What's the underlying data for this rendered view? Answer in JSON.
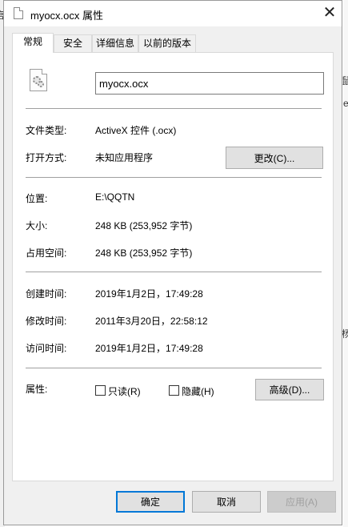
{
  "background": {
    "left_fragment": "官",
    "right_fragments": [
      "鼠",
      "e",
      "杨"
    ]
  },
  "window": {
    "title": "myocx.ocx 属性",
    "close_glyph": "✕"
  },
  "tabs": [
    {
      "label": "常规",
      "active": true
    },
    {
      "label": "安全",
      "active": false
    },
    {
      "label": "详细信息",
      "active": false
    },
    {
      "label": "以前的版本",
      "active": false
    }
  ],
  "general": {
    "file_icon": "gear-file-icon",
    "filename": "myocx.ocx",
    "file_type": {
      "label": "文件类型:",
      "value": "ActiveX 控件 (.ocx)"
    },
    "opens_with": {
      "label": "打开方式:",
      "value": "未知应用程序",
      "button": "更改(C)..."
    },
    "location": {
      "label": "位置:",
      "value": "E:\\QQTN"
    },
    "size": {
      "label": "大小:",
      "value": "248 KB (253,952 字节)"
    },
    "size_on_disk": {
      "label": "占用空间:",
      "value": "248 KB (253,952 字节)"
    },
    "created": {
      "label": "创建时间:",
      "value": "2019年1月2日，17:49:28"
    },
    "modified": {
      "label": "修改时间:",
      "value": "2011年3月20日，22:58:12"
    },
    "accessed": {
      "label": "访问时间:",
      "value": "2019年1月2日，17:49:28"
    },
    "attributes": {
      "label": "属性:",
      "readonly": {
        "label": "只读(R)",
        "checked": false
      },
      "hidden": {
        "label": "隐藏(H)",
        "checked": false
      },
      "advanced_button": "高级(D)..."
    }
  },
  "footer": {
    "ok": "确定",
    "cancel": "取消",
    "apply": "应用(A)"
  },
  "colors": {
    "accent": "#0078d7",
    "dialog_bg": "#f0f0f0",
    "panel_bg": "#ffffff"
  }
}
